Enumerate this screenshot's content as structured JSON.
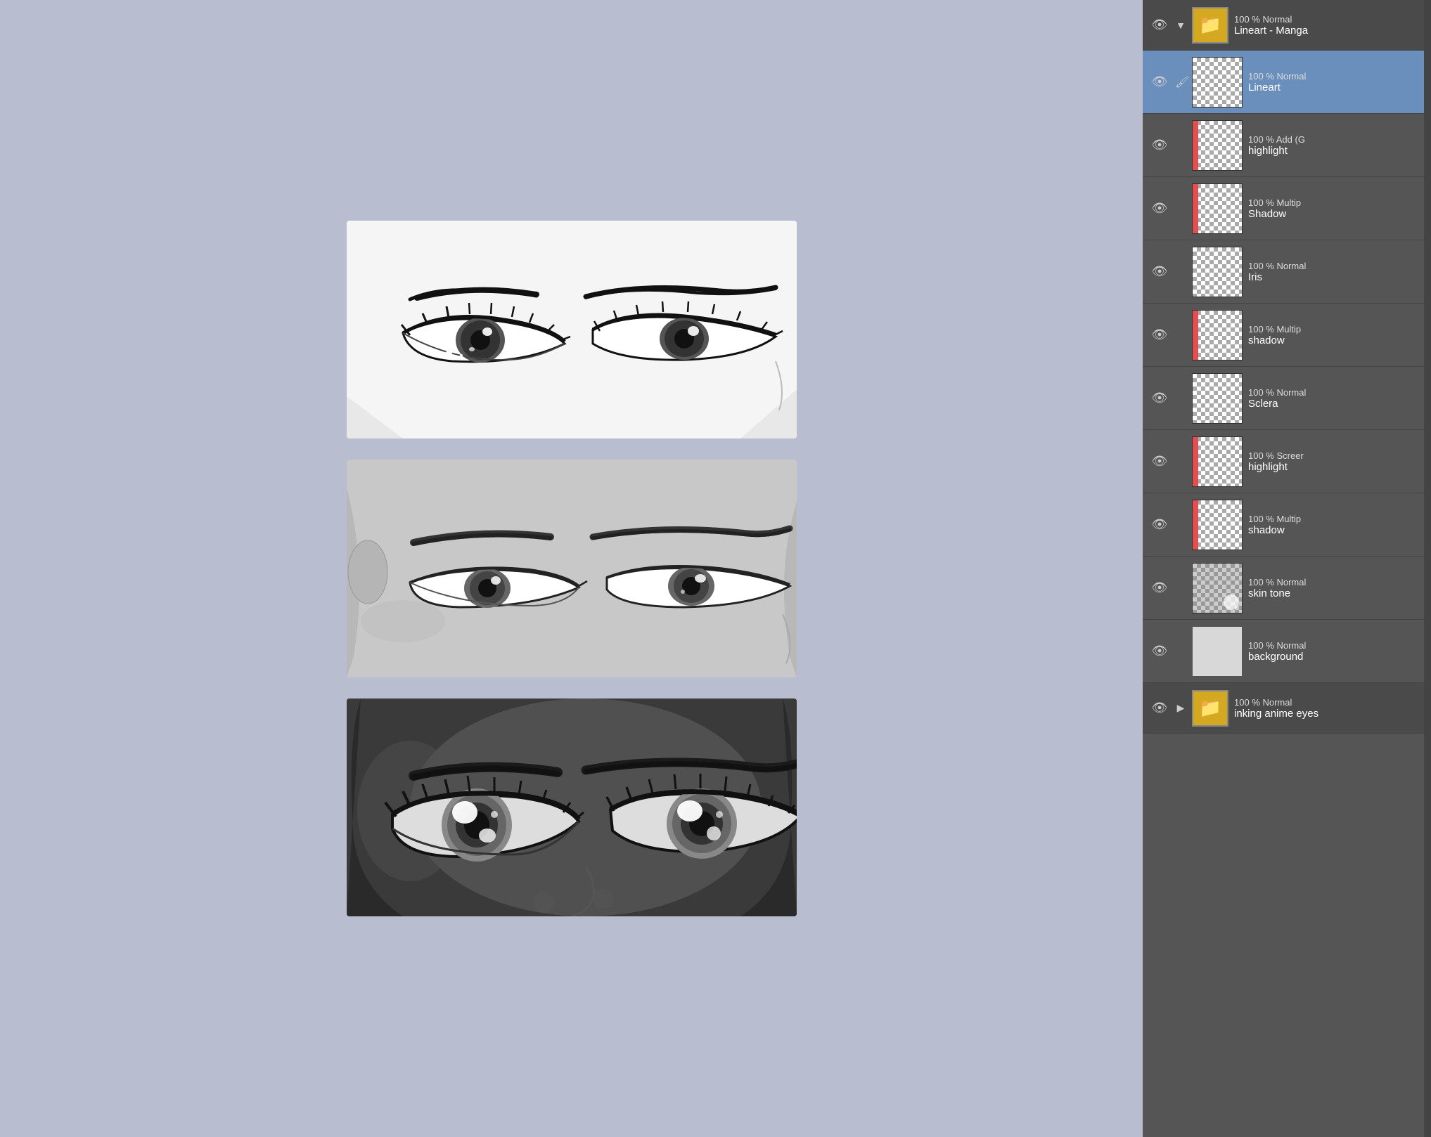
{
  "canvas": {
    "panels": [
      {
        "id": "panel-1",
        "description": "Light manga eyes - female style"
      },
      {
        "id": "panel-2",
        "description": "Gray manga eyes - male style"
      },
      {
        "id": "panel-3",
        "description": "Dark skin manga eyes - anime style"
      }
    ]
  },
  "layers": {
    "folder_top": {
      "label": "100 % Normal",
      "name": "Lineart - Manga",
      "opacity": "100 %",
      "blend": "Normal"
    },
    "items": [
      {
        "id": "lineart",
        "selected": true,
        "red_bar": false,
        "blend": "100 %  Normal",
        "name": "Lineart",
        "has_brush": true,
        "thumb": "checker"
      },
      {
        "id": "highlight",
        "selected": false,
        "red_bar": true,
        "blend": "100 %  Add (G",
        "name": "highlight",
        "has_brush": false,
        "thumb": "checker"
      },
      {
        "id": "shadow1",
        "selected": false,
        "red_bar": true,
        "blend": "100 %  Multip",
        "name": "Shadow",
        "has_brush": false,
        "thumb": "checker"
      },
      {
        "id": "iris",
        "selected": false,
        "red_bar": false,
        "blend": "100 %  Normal",
        "name": "Iris",
        "has_brush": false,
        "thumb": "checker"
      },
      {
        "id": "shadow2",
        "selected": false,
        "red_bar": true,
        "blend": "100 %  Multip",
        "name": "shadow",
        "has_brush": false,
        "thumb": "checker"
      },
      {
        "id": "sclera",
        "selected": false,
        "red_bar": false,
        "blend": "100 %  Normal",
        "name": "Sclera",
        "has_brush": false,
        "thumb": "checker"
      },
      {
        "id": "highlight2",
        "selected": false,
        "red_bar": true,
        "blend": "100 %  Screer",
        "name": "highlight",
        "has_brush": false,
        "thumb": "checker"
      },
      {
        "id": "shadow3",
        "selected": false,
        "red_bar": true,
        "blend": "100 %  Multip",
        "name": "shadow",
        "has_brush": false,
        "thumb": "checker"
      },
      {
        "id": "skintone",
        "selected": false,
        "red_bar": false,
        "blend": "100 %  Normal",
        "name": "skin tone",
        "has_brush": false,
        "thumb": "checker-dark"
      },
      {
        "id": "background",
        "selected": false,
        "red_bar": false,
        "blend": "100 %  Normal",
        "name": "background",
        "has_brush": false,
        "thumb": "white"
      }
    ],
    "folder_bottom": {
      "label": "100 % Normal",
      "name": "inking anime eyes",
      "opacity": "100 %",
      "blend": "Normal"
    }
  }
}
